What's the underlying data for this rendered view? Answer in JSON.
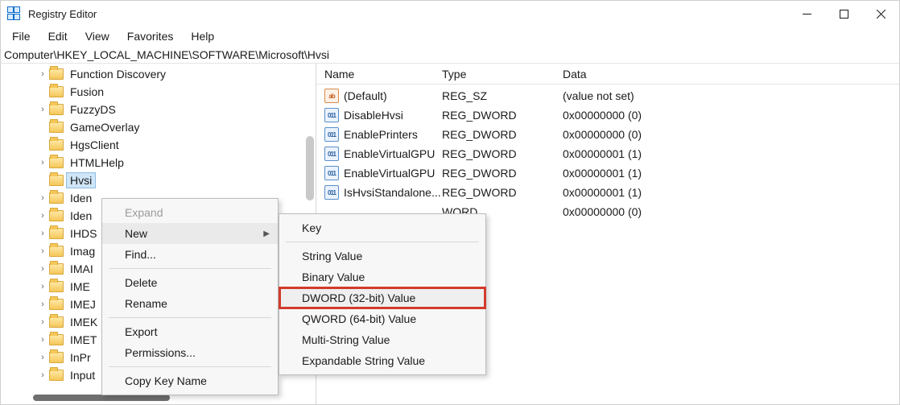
{
  "window": {
    "title": "Registry Editor"
  },
  "menubar": [
    "File",
    "Edit",
    "View",
    "Favorites",
    "Help"
  ],
  "address": "Computer\\HKEY_LOCAL_MACHINE\\SOFTWARE\\Microsoft\\Hvsi",
  "tree": [
    {
      "label": "Function Discovery",
      "expandable": true,
      "selected": false
    },
    {
      "label": "Fusion",
      "expandable": false,
      "selected": false
    },
    {
      "label": "FuzzyDS",
      "expandable": true,
      "selected": false
    },
    {
      "label": "GameOverlay",
      "expandable": false,
      "selected": false
    },
    {
      "label": "HgsClient",
      "expandable": false,
      "selected": false
    },
    {
      "label": "HTMLHelp",
      "expandable": true,
      "selected": false
    },
    {
      "label": "Hvsi",
      "expandable": false,
      "selected": true
    },
    {
      "label": "Iden",
      "expandable": true,
      "selected": false
    },
    {
      "label": "Iden",
      "expandable": true,
      "selected": false
    },
    {
      "label": "IHDS",
      "expandable": true,
      "selected": false
    },
    {
      "label": "Imag",
      "expandable": true,
      "selected": false
    },
    {
      "label": "IMAI",
      "expandable": true,
      "selected": false
    },
    {
      "label": "IME",
      "expandable": true,
      "selected": false
    },
    {
      "label": "IMEJ",
      "expandable": true,
      "selected": false
    },
    {
      "label": "IMEK",
      "expandable": true,
      "selected": false
    },
    {
      "label": "IMET",
      "expandable": true,
      "selected": false
    },
    {
      "label": "InPr",
      "expandable": true,
      "selected": false
    },
    {
      "label": "Input",
      "expandable": true,
      "selected": false
    }
  ],
  "columns": {
    "name": "Name",
    "type": "Type",
    "data": "Data"
  },
  "values": [
    {
      "icon": "str",
      "name": "(Default)",
      "type": "REG_SZ",
      "data": "(value not set)"
    },
    {
      "icon": "bin",
      "name": "DisableHvsi",
      "type": "REG_DWORD",
      "data": "0x00000000 (0)"
    },
    {
      "icon": "bin",
      "name": "EnablePrinters",
      "type": "REG_DWORD",
      "data": "0x00000000 (0)"
    },
    {
      "icon": "bin",
      "name": "EnableVirtualGPU",
      "type": "REG_DWORD",
      "data": "0x00000001 (1)"
    },
    {
      "icon": "bin",
      "name": "EnableVirtualGPU",
      "type": "REG_DWORD",
      "data": "0x00000001 (1)"
    },
    {
      "icon": "bin",
      "name": "IsHvsiStandalone...",
      "type": "REG_DWORD",
      "data": "0x00000001 (1)"
    },
    {
      "icon": "",
      "name": "",
      "type": "WORD",
      "data": "0x00000000 (0)"
    }
  ],
  "context_main": {
    "expand": "Expand",
    "new": "New",
    "find": "Find...",
    "delete": "Delete",
    "rename": "Rename",
    "export": "Export",
    "permissions": "Permissions...",
    "copy_key_name": "Copy Key Name"
  },
  "context_sub": {
    "key": "Key",
    "string_value": "String Value",
    "binary_value": "Binary Value",
    "dword_value": "DWORD (32-bit) Value",
    "qword_value": "QWORD (64-bit) Value",
    "multi_string_value": "Multi-String Value",
    "expandable_string_value": "Expandable String Value"
  },
  "icon_text": {
    "str": "ab",
    "bin": "011"
  }
}
